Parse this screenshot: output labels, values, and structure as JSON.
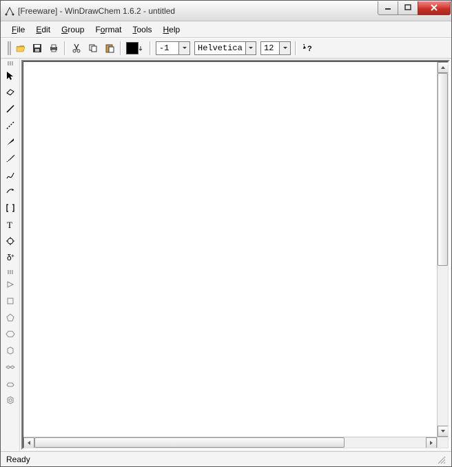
{
  "window": {
    "title": "[Freeware] - WinDrawChem 1.6.2 - untitled"
  },
  "menu": {
    "file": {
      "key": "F",
      "rest": "ile"
    },
    "edit": {
      "key": "E",
      "rest": "dit"
    },
    "group": {
      "key": "G",
      "rest": "roup"
    },
    "format": {
      "key": "F",
      "rest": "ormat"
    },
    "tools": {
      "key": "T",
      "rest": "ools"
    },
    "help": {
      "key": "H",
      "rest": "elp"
    }
  },
  "toolbar": {
    "line_thickness": "-1",
    "font_name": "Helvetica",
    "font_size": "12"
  },
  "status": {
    "text": "Ready"
  }
}
